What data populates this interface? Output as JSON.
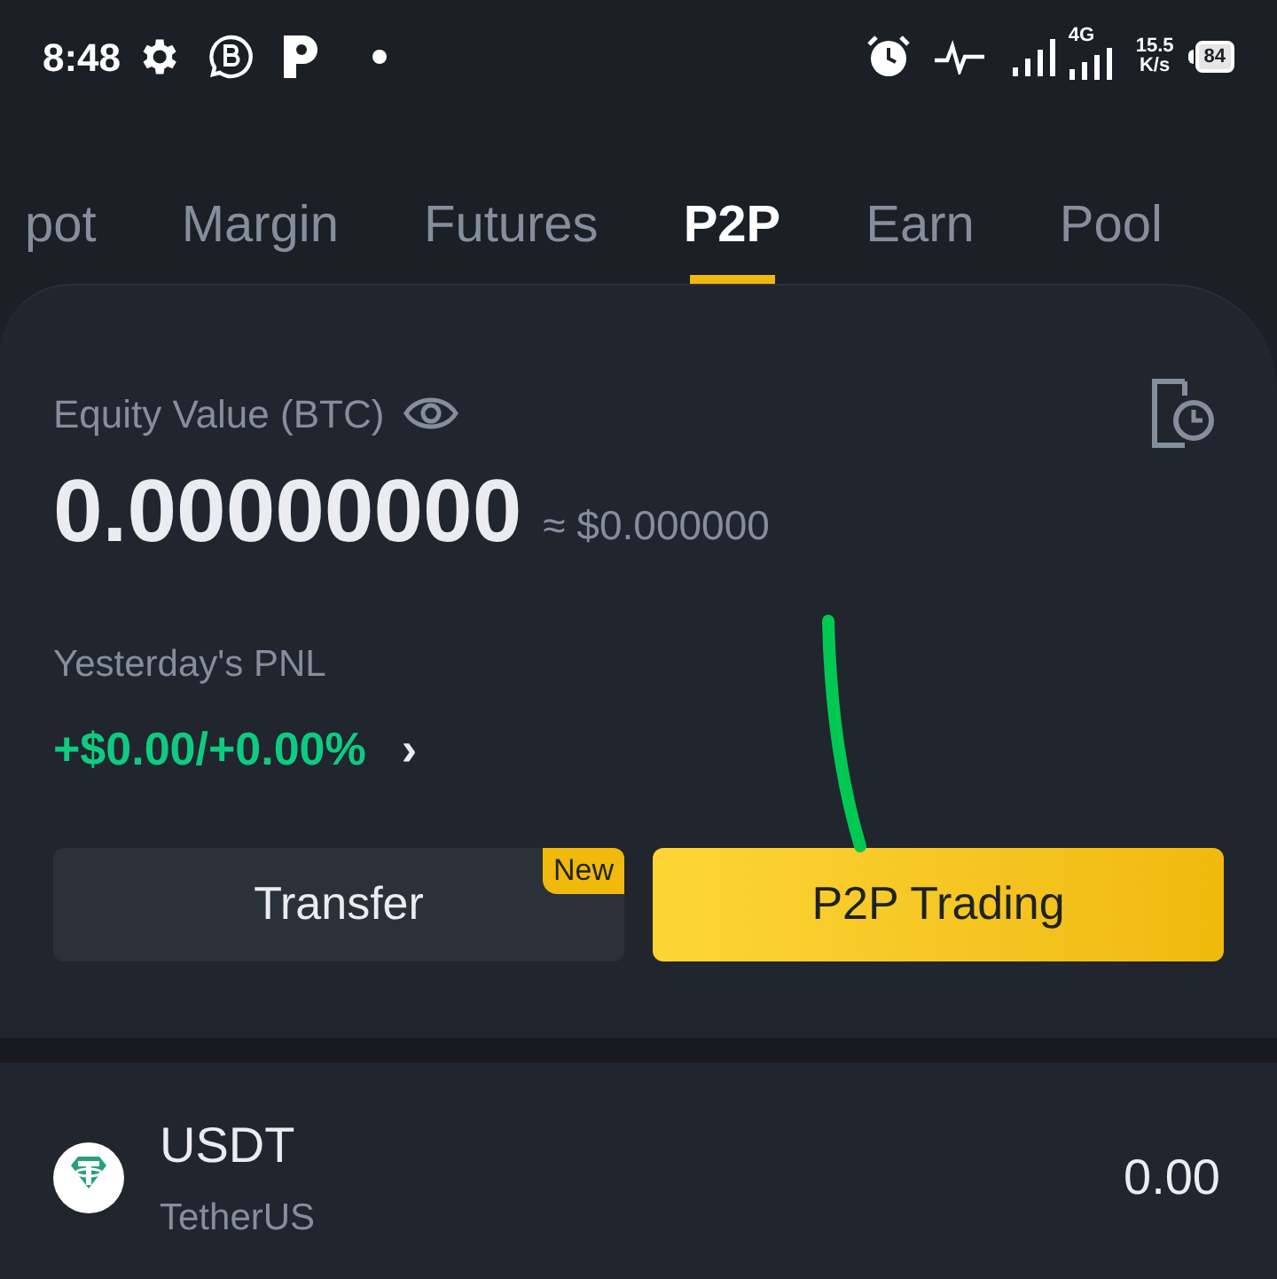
{
  "status_bar": {
    "time": "8:48",
    "network_type": "4G",
    "speed_value": "15.5",
    "speed_unit": "K/s",
    "battery": "84"
  },
  "tabs": [
    {
      "label": "pot",
      "selected": false
    },
    {
      "label": "Margin",
      "selected": false
    },
    {
      "label": "Futures",
      "selected": false
    },
    {
      "label": "P2P",
      "selected": true
    },
    {
      "label": "Earn",
      "selected": false
    },
    {
      "label": "Pool",
      "selected": false
    }
  ],
  "card": {
    "equity_label": "Equity Value (BTC)",
    "equity_value": "0.00000000",
    "equity_usd": "≈ $0.000000",
    "pnl_label": "Yesterday's PNL",
    "pnl_value": "+$0.00/+0.00%",
    "pnl_arrow": "›",
    "buttons": [
      {
        "kind": "secondary",
        "label": "Transfer",
        "badge": "New"
      },
      {
        "kind": "primary",
        "label": "P2P Trading"
      }
    ]
  },
  "assets": [
    {
      "symbol": "USDT",
      "name": "TetherUS",
      "amount": "0.00"
    }
  ]
}
